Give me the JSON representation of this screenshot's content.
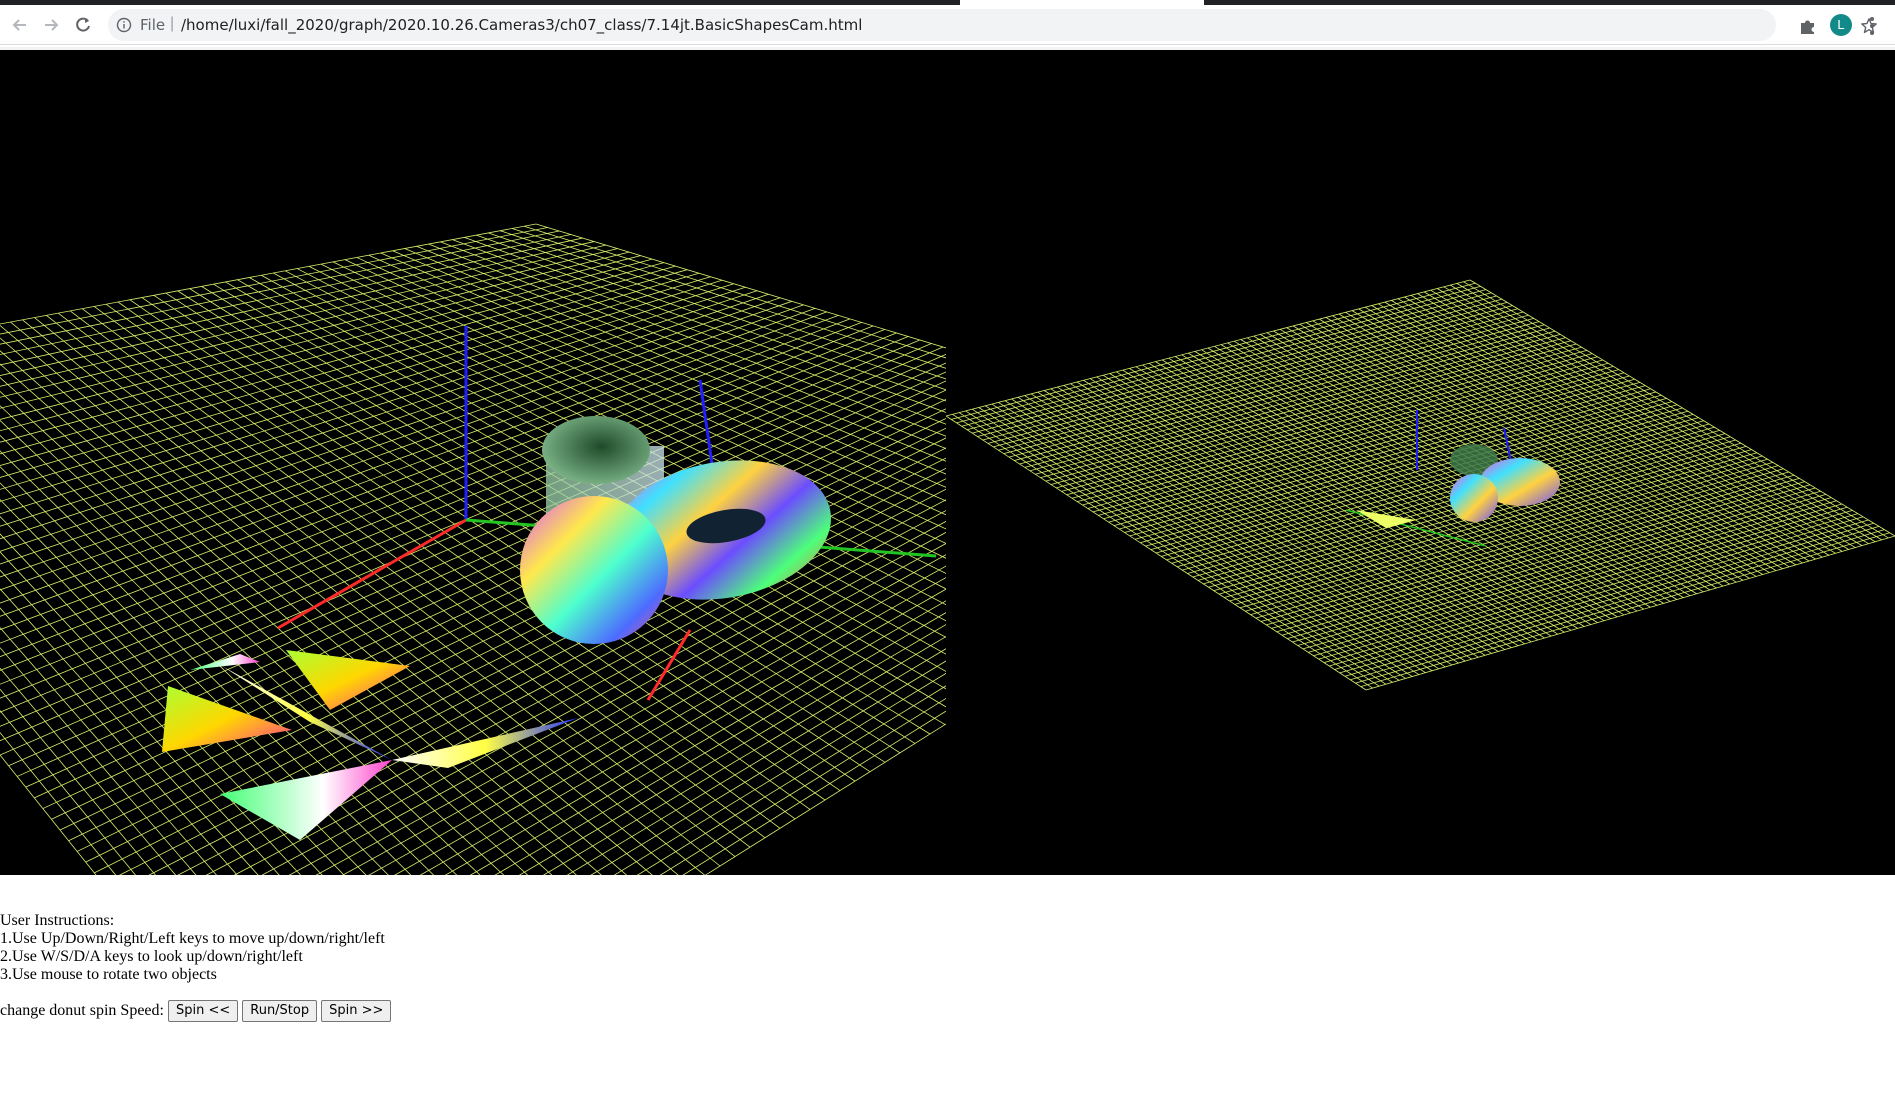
{
  "browser": {
    "omnibox": {
      "scheme_label": "File",
      "url": "/home/luxi/fall_2020/graph/2020.10.26.Cameras3/ch07_class/7.14jt.BasicShapesCam.html"
    },
    "profile_initial": "L",
    "icons": [
      "back-arrow-icon",
      "forward-arrow-icon",
      "reload-icon",
      "info-icon",
      "star-icon",
      "puzzle-extension-icon",
      "kebab-menu-icon"
    ]
  },
  "scene": {
    "background": "#000000",
    "grid_color": "#d4f06a",
    "axis_colors": {
      "x": "#ff2a2a",
      "y": "#22c622",
      "z": "#2020ff"
    }
  },
  "instructions": {
    "heading": "User Instructions:",
    "items": [
      "1.Use Up/Down/Right/Left keys to move up/down/right/left",
      "2.Use W/S/D/A keys to look up/down/right/left",
      "3.Use mouse to rotate two objects"
    ]
  },
  "spin_controls": {
    "label": "change donut spin Speed:",
    "buttons": [
      "Spin <<",
      "Run/Stop",
      "Spin >>"
    ]
  }
}
